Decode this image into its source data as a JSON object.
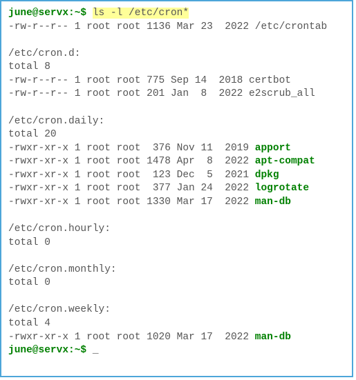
{
  "prompt": {
    "text": "june@servx:~$ ",
    "command": "ls -l /etc/cron*"
  },
  "out": {
    "crontab": "-rw-r--r-- 1 root root 1136 Mar 23  2022 /etc/crontab",
    "crond_header": "/etc/cron.d:",
    "crond_total": "total 8",
    "crond_1": "-rw-r--r-- 1 root root 775 Sep 14  2018 certbot",
    "crond_2": "-rw-r--r-- 1 root root 201 Jan  8  2022 e2scrub_all",
    "daily_header": "/etc/cron.daily:",
    "daily_total": "total 20",
    "daily_1_pre": "-rwxr-xr-x 1 root root  376 Nov 11  2019 ",
    "daily_1_name": "apport",
    "daily_2_pre": "-rwxr-xr-x 1 root root 1478 Apr  8  2022 ",
    "daily_2_name": "apt-compat",
    "daily_3_pre": "-rwxr-xr-x 1 root root  123 Dec  5  2021 ",
    "daily_3_name": "dpkg",
    "daily_4_pre": "-rwxr-xr-x 1 root root  377 Jan 24  2022 ",
    "daily_4_name": "logrotate",
    "daily_5_pre": "-rwxr-xr-x 1 root root 1330 Mar 17  2022 ",
    "daily_5_name": "man-db",
    "hourly_header": "/etc/cron.hourly:",
    "hourly_total": "total 0",
    "monthly_header": "/etc/cron.monthly:",
    "monthly_total": "total 0",
    "weekly_header": "/etc/cron.weekly:",
    "weekly_total": "total 4",
    "weekly_1_pre": "-rwxr-xr-x 1 root root 1020 Mar 17  2022 ",
    "weekly_1_name": "man-db"
  },
  "cursor": "_"
}
